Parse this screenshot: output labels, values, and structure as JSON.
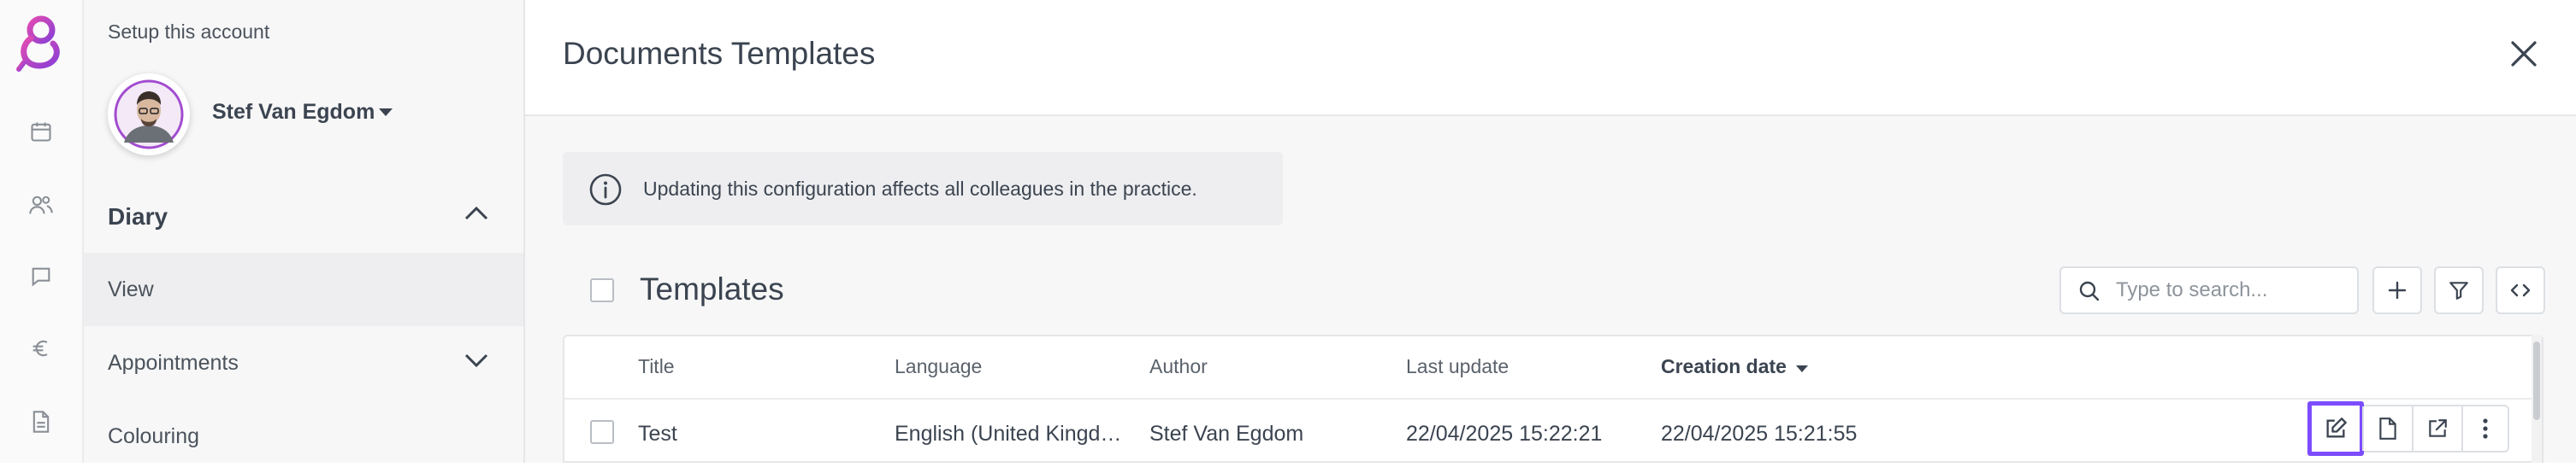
{
  "sidebar": {
    "setup_label": "Setup this account",
    "user_name": "Stef Van Egdom",
    "section": "Diary",
    "items": [
      {
        "label": "View"
      },
      {
        "label": "Appointments"
      },
      {
        "label": "Colouring"
      }
    ]
  },
  "panel": {
    "title": "Documents Templates",
    "notice": "Updating this configuration affects all colleagues in the practice.",
    "list_title": "Templates",
    "search_placeholder": "Type to search..."
  },
  "table": {
    "columns": [
      "Title",
      "Language",
      "Author",
      "Last update",
      "Creation date"
    ],
    "sorted_column": "Creation date",
    "rows": [
      {
        "title": "Test",
        "language": "English (United Kingd…",
        "author": "Stef Van Egdom",
        "last_update": "22/04/2025 15:22:21",
        "creation_date": "22/04/2025 15:21:55"
      }
    ]
  },
  "colors": {
    "brand": "#a24bd0",
    "highlight": "#7c4dff",
    "text": "#3b4450"
  },
  "icons": [
    "app-logo-icon",
    "calendar-icon",
    "people-icon",
    "chat-icon",
    "euro-icon",
    "document-icon",
    "chevron-up-icon",
    "chevron-down-icon",
    "close-icon",
    "info-icon",
    "search-icon",
    "plus-icon",
    "filter-icon",
    "code-icon",
    "edit-icon",
    "file-icon",
    "external-link-icon",
    "more-vertical-icon"
  ]
}
